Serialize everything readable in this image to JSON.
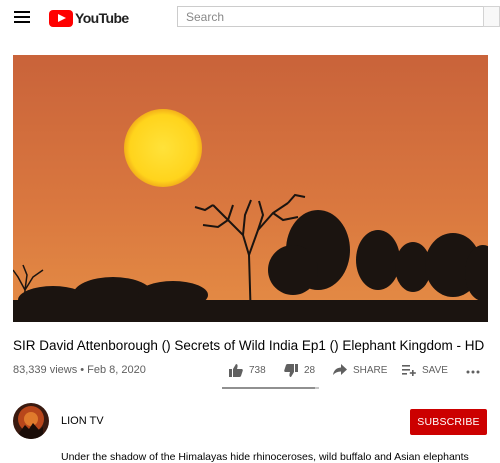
{
  "masthead": {
    "logo_text": "YouTube",
    "search_placeholder": "Search"
  },
  "video": {
    "title": "SIR David Attenborough () Secrets of Wild India Ep1 () Elephant Kingdom - HD",
    "meta": "83,339 views • Feb 8, 2020",
    "like_ratio": 0.96,
    "actions": {
      "like_count": "738",
      "dislike_count": "28",
      "share_label": "SHARE",
      "save_label": "SAVE"
    }
  },
  "owner": {
    "channel_name": "LION TV",
    "subscribe_label": "SUBSCRIBE"
  },
  "description": {
    "text": "Under the shadow of the Himalayas hide rhinoceroses, wild buffalo and Asian elephants"
  },
  "colors": {
    "brand_red": "#ff0000",
    "subscribe_red": "#cc0000",
    "secondary_text": "#606060"
  }
}
